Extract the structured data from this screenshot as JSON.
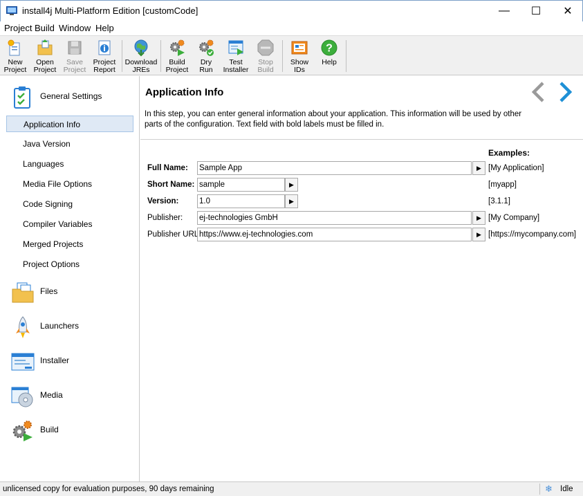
{
  "window": {
    "title": "install4j Multi-Platform Edition [customCode]",
    "minimize_glyph": "—",
    "maximize_glyph": "☐",
    "close_glyph": "✕"
  },
  "menu": [
    "Project",
    "Build",
    "Window",
    "Help"
  ],
  "toolbar": [
    {
      "line1": "New",
      "line2": "Project",
      "icon": "new-project-icon",
      "enabled": true
    },
    {
      "line1": "Open",
      "line2": "Project",
      "icon": "open-project-icon",
      "enabled": true
    },
    {
      "line1": "Save",
      "line2": "Project",
      "icon": "save-project-icon",
      "enabled": false
    },
    {
      "line1": "Project",
      "line2": "Report",
      "icon": "project-report-icon",
      "enabled": true
    },
    {
      "line1": "Download",
      "line2": "JREs",
      "icon": "download-jres-icon",
      "enabled": true
    },
    {
      "line1": "Build",
      "line2": "Project",
      "icon": "build-project-icon",
      "enabled": true
    },
    {
      "line1": "Dry",
      "line2": "Run",
      "icon": "dry-run-icon",
      "enabled": true
    },
    {
      "line1": "Test",
      "line2": "Installer",
      "icon": "test-installer-icon",
      "enabled": true
    },
    {
      "line1": "Stop",
      "line2": "Build",
      "icon": "stop-build-icon",
      "enabled": false
    },
    {
      "line1": "Show",
      "line2": "IDs",
      "icon": "show-ids-icon",
      "enabled": true
    },
    {
      "line1": "Help",
      "line2": "",
      "icon": "help-icon",
      "enabled": true
    }
  ],
  "sidebar": {
    "general": "General Settings",
    "sub_items": [
      "Application Info",
      "Java Version",
      "Languages",
      "Media File Options",
      "Code Signing",
      "Compiler Variables",
      "Merged Projects",
      "Project Options"
    ],
    "sections": [
      "Files",
      "Launchers",
      "Installer",
      "Media",
      "Build"
    ]
  },
  "page": {
    "title": "Application Info",
    "description": "In this step, you can enter general information about your application. This information will be used by other parts of the configuration. Text field with bold labels must be filled in.",
    "examples_header": "Examples:",
    "fields": [
      {
        "label": "Full Name:",
        "bold": true,
        "value": "Sample App",
        "example": "[My Application]"
      },
      {
        "label": "Short Name:",
        "bold": true,
        "value": "sample",
        "example": "[myapp]"
      },
      {
        "label": "Version:",
        "bold": true,
        "value": "1.0",
        "example": "[3.1.1]"
      },
      {
        "label": "Publisher:",
        "bold": false,
        "value": "ej-technologies GmbH",
        "example": "[My Company]"
      },
      {
        "label": "Publisher URL:",
        "bold": false,
        "value": "https://www.ej-technologies.com",
        "example": "[https://mycompany.com]"
      }
    ]
  },
  "status": {
    "message": "unlicensed copy for evaluation purposes, 90 days remaining",
    "state": "Idle"
  },
  "colors": {
    "accent": "#1e90d6",
    "selection_bg": "#dfe9f5"
  }
}
